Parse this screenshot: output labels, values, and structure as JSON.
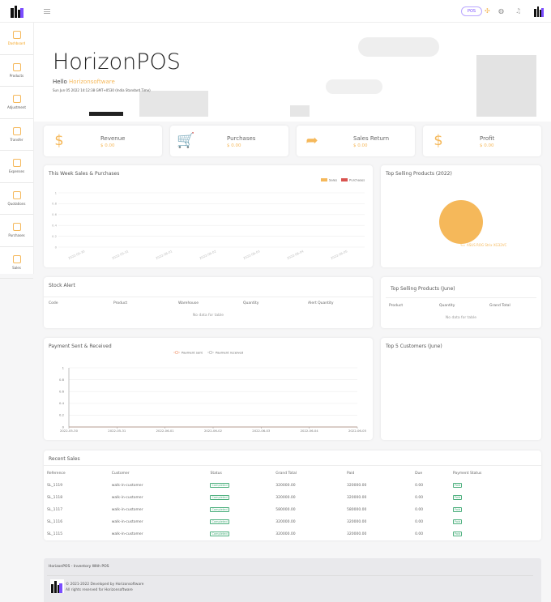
{
  "header": {
    "pos_label": "POS",
    "icons": [
      "menu-icon",
      "fullscreen-icon",
      "globe-icon",
      "bell-icon",
      "avatar"
    ]
  },
  "sidebar": {
    "items": [
      {
        "label": "Dashboard",
        "icon": "dashboard-icon",
        "active": true
      },
      {
        "label": "Products",
        "icon": "products-icon"
      },
      {
        "label": "Adjustment",
        "icon": "adjustment-icon"
      },
      {
        "label": "Transfer",
        "icon": "transfer-icon"
      },
      {
        "label": "Expenses",
        "icon": "expenses-icon"
      },
      {
        "label": "Quotations",
        "icon": "quotations-icon"
      },
      {
        "label": "Purchases",
        "icon": "purchases-icon"
      },
      {
        "label": "Sales",
        "icon": "sales-icon"
      }
    ]
  },
  "hero": {
    "title": "HorizonPOS",
    "hello": "Hello",
    "user": "Horizonsoftware",
    "datetime": "Sun Jun 05 2022 14:12:38 GMT+0530 (India Standard Time)"
  },
  "stats": [
    {
      "label": "Revenue",
      "value": "$ 0.00",
      "icon": "$"
    },
    {
      "label": "Purchases",
      "value": "$ 0.00",
      "icon": "🛒"
    },
    {
      "label": "Sales Return",
      "value": "$ 0.00",
      "icon": "➦"
    },
    {
      "label": "Profit",
      "value": "$ 0.00",
      "icon": "$"
    }
  ],
  "colors": {
    "accent": "#f5b85a",
    "sales": "#f5b85a",
    "purchases": "#d9534f",
    "sidebar_brand": "#7b4dff"
  },
  "chart_data": [
    {
      "type": "bar",
      "title": "This Week Sales & Purchases",
      "categories": [
        "2022-05-30",
        "2022-05-31",
        "2022-06-01",
        "2022-06-02",
        "2022-06-03",
        "2022-06-04",
        "2022-06-05"
      ],
      "series": [
        {
          "name": "Sales",
          "values": [
            0,
            0,
            0,
            0,
            0,
            0,
            0
          ]
        },
        {
          "name": "Purchases",
          "values": [
            0,
            0,
            0,
            0,
            0,
            0,
            0
          ]
        }
      ],
      "yticks": [
        "0",
        "0.2",
        "0.4",
        "0.6",
        "0.8",
        "1"
      ],
      "ylim": [
        0,
        1
      ],
      "legend": "top-right",
      "grid": true
    },
    {
      "type": "pie",
      "title": "Top Selling Products (2022)",
      "categories": [
        "ASUS ROG Strix XG32VC"
      ],
      "values": [
        100
      ]
    },
    {
      "type": "line",
      "title": "Payment Sent & Received",
      "categories": [
        "2022-05-30",
        "2022-05-31",
        "2022-06-01",
        "2022-06-02",
        "2022-06-03",
        "2022-06-04",
        "2022-06-05"
      ],
      "series": [
        {
          "name": "Payment sent",
          "values": [
            0,
            0,
            0,
            0,
            0,
            0,
            0
          ]
        },
        {
          "name": "Payment received",
          "values": [
            0,
            0,
            0,
            0,
            0,
            0,
            0
          ]
        }
      ],
      "yticks": [
        "0",
        "0.2",
        "0.4",
        "0.6",
        "0.8",
        "1"
      ],
      "ylim": [
        0,
        1
      ],
      "legend": "top",
      "grid": true
    }
  ],
  "stock_alert": {
    "title": "Stock Alert",
    "columns": [
      "Code",
      "Product",
      "Warehouse",
      "Quantity",
      "Alert Quantity"
    ],
    "empty": "No data for table"
  },
  "top_june": {
    "title": "Top Selling Products (June)",
    "columns": [
      "Product",
      "Quantity",
      "Grand Total"
    ],
    "empty": "No data for table"
  },
  "top_customers": {
    "title": "Top 5 Customers (June)"
  },
  "recent_sales": {
    "title": "Recent Sales",
    "columns": [
      "Reference",
      "Customer",
      "Status",
      "Grand Total",
      "Paid",
      "Due",
      "Payment Status"
    ],
    "rows": [
      [
        "SL_1119",
        "walk-in-customer",
        "Completed",
        "320000.00",
        "320000.00",
        "0.00",
        "Paid"
      ],
      [
        "SL_1118",
        "walk-in-customer",
        "Completed",
        "320000.00",
        "320000.00",
        "0.00",
        "Paid"
      ],
      [
        "SL_1117",
        "walk-in-customer",
        "Completed",
        "580000.00",
        "580000.00",
        "0.00",
        "Paid"
      ],
      [
        "SL_1116",
        "walk-in-customer",
        "Completed",
        "320000.00",
        "320000.00",
        "0.00",
        "Paid"
      ],
      [
        "SL_1115",
        "walk-in-customer",
        "Completed",
        "320000.00",
        "320000.00",
        "0.00",
        "Paid"
      ]
    ]
  },
  "footer": {
    "title": "HorizonPOS - Inventory With POS",
    "copyright": "© 2021-2022 Developed by Horizonsoftware",
    "rights": "All rights reserved for Horizonsoftware"
  }
}
